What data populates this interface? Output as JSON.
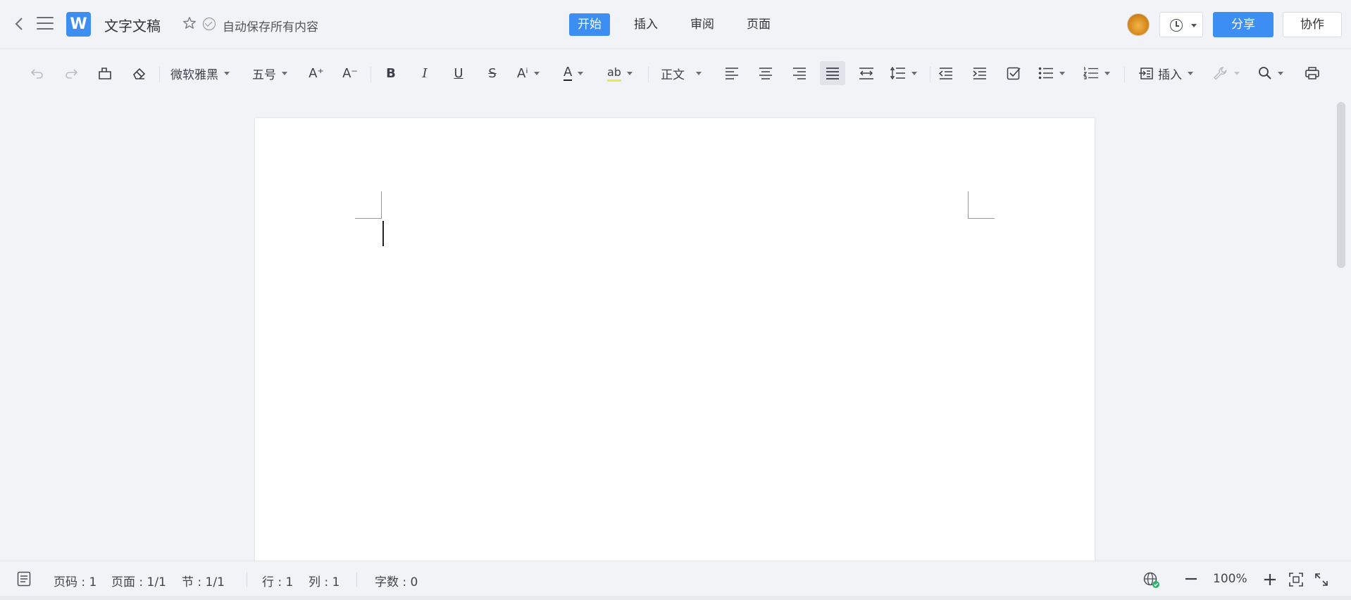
{
  "header": {
    "logo_letter": "W",
    "doc_title": "文字文稿",
    "autosave_text": "自动保存所有内容",
    "tabs": [
      {
        "label": "开始",
        "active": true
      },
      {
        "label": "插入",
        "active": false
      },
      {
        "label": "审阅",
        "active": false
      },
      {
        "label": "页面",
        "active": false
      }
    ],
    "share_label": "分享",
    "collab_label": "协作",
    "accent_color": "#3c8ef2"
  },
  "toolbar": {
    "font_family": "微软雅黑",
    "font_size": "五号",
    "style": "正文",
    "insert_label": "插入",
    "bold_glyph": "B",
    "italic_glyph": "I",
    "underline_glyph": "U",
    "strike_glyph": "S",
    "grow_glyph": "A⁺",
    "shrink_glyph": "A⁻",
    "effects_glyph": "Aⁱ",
    "font_color_glyph": "A",
    "highlight_glyph": "ab"
  },
  "status": {
    "page_no": "页码 : 1",
    "pages": "页面 : 1/1",
    "section": "节 : 1/1",
    "line": "行 : 1",
    "column": "列 : 1",
    "word_count": "字数 : 0",
    "zoom": "100%"
  }
}
